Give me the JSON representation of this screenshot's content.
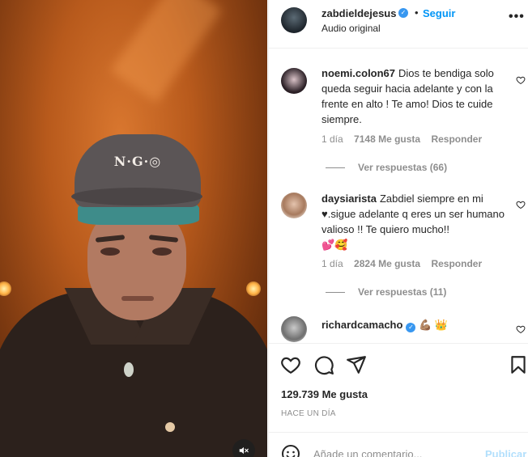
{
  "post": {
    "username": "zabdieldejesus",
    "follow_label": "Seguir",
    "separator": "•",
    "audio": "Audio original",
    "more": "•••"
  },
  "comments": [
    {
      "user": "noemi.colon67",
      "text": "Dios te bendiga solo queda seguir hacia adelante y con la frente en alto ! Te amo! Dios te cuide siempre.",
      "time": "1 día",
      "likes": "7148 Me gusta",
      "reply": "Responder",
      "view_replies": "Ver respuestas (66)"
    },
    {
      "user": "daysiarista",
      "text": "Zabdiel siempre en mi ♥.sigue adelante q eres un ser humano valioso !! Te quiero mucho!!",
      "emojis": "💕🥰",
      "time": "1 día",
      "likes": "2824 Me gusta",
      "reply": "Responder",
      "view_replies": "Ver respuestas (11)"
    },
    {
      "user": "richardcamacho",
      "emojis": "💪🏽 👑"
    }
  ],
  "actions": {
    "likes": "129.739 Me gusta",
    "time": "HACE UN DÍA"
  },
  "add_comment": {
    "placeholder": "Añade un comentario...",
    "publish_label": "Publicar"
  },
  "video": {
    "cap_logo": "N·G·◎"
  },
  "icons": {
    "verified": "verified-badge-icon",
    "heart": "heart-icon",
    "comment": "comment-icon",
    "share": "paper-plane-icon",
    "save": "bookmark-icon",
    "emoji": "emoji-icon",
    "mute": "muted-speaker-icon"
  },
  "colors": {
    "accent": "#0095f6",
    "publish_disabled": "#b2dffc",
    "verified": "#3897f0",
    "muted_text": "#8e8e8e"
  }
}
